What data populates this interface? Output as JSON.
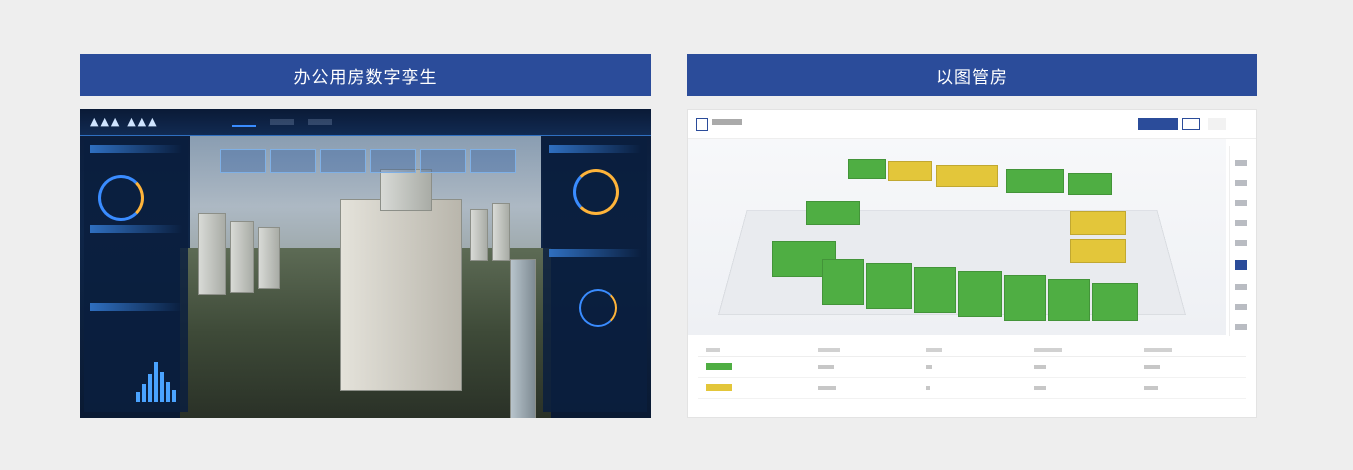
{
  "panels": [
    {
      "title": "办公用房数字孪生",
      "screenshot": "digital-twin-dashboard"
    },
    {
      "title": "以图管房",
      "screenshot": "floor-plan-view"
    }
  ],
  "colors": {
    "background": "#eeeeee",
    "banner": "#2b4c9a",
    "banner_text": "#ffffff",
    "room_green": "#4fae43",
    "room_yellow": "#e3c63a"
  }
}
